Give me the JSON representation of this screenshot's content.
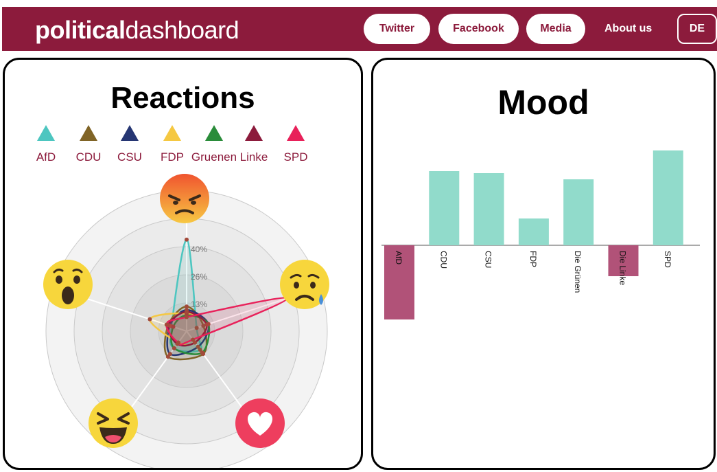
{
  "header": {
    "logo_bold": "political",
    "logo_light": "dashboard",
    "bg_color": "#8c1b3c",
    "nav": {
      "twitter": "Twitter",
      "facebook": "Facebook",
      "media": "Media",
      "about": "About us",
      "lang": "DE"
    }
  },
  "reactions": {
    "title": "Reactions",
    "legend": [
      {
        "label": "AfD",
        "color": "#4dc6c0"
      },
      {
        "label": "CDU",
        "color": "#806426"
      },
      {
        "label": "CSU",
        "color": "#263673"
      },
      {
        "label": "FDP",
        "color": "#f5c842"
      },
      {
        "label": "Gruenen",
        "color": "#2a8c3a"
      },
      {
        "label": "Linke",
        "color": "#8c1b3c"
      },
      {
        "label": "SPD",
        "color": "#e8215a"
      }
    ],
    "emoji_icons": [
      "angry-face-icon",
      "sad-face-icon",
      "heart-icon",
      "laughing-face-icon",
      "wow-face-icon"
    ],
    "ring_labels": [
      "40%",
      "26%",
      "13%"
    ]
  },
  "chart_data": [
    {
      "type": "radar",
      "title": "Reactions",
      "axes": [
        "angry",
        "sad",
        "love",
        "haha",
        "wow"
      ],
      "rmax": 60,
      "tick_labels": [
        "13%",
        "26%",
        "40%"
      ],
      "series": [
        {
          "name": "AfD",
          "color": "#4dc6c0",
          "values": [
            52,
            6,
            13,
            12,
            9
          ]
        },
        {
          "name": "CDU",
          "color": "#806426",
          "values": [
            14,
            10,
            16,
            18,
            11
          ]
        },
        {
          "name": "CSU",
          "color": "#263673",
          "values": [
            12,
            13,
            11,
            16,
            10
          ]
        },
        {
          "name": "FDP",
          "color": "#f5c842",
          "values": [
            10,
            12,
            8,
            8,
            22
          ]
        },
        {
          "name": "Gruenen",
          "color": "#2a8c3a",
          "values": [
            9,
            13,
            15,
            12,
            8
          ]
        },
        {
          "name": "Linke",
          "color": "#8c1b3c",
          "values": [
            11,
            12,
            8,
            9,
            11
          ]
        },
        {
          "name": "SPD",
          "color": "#e8215a",
          "values": [
            8,
            60,
            6,
            8,
            12
          ]
        }
      ]
    },
    {
      "type": "bar",
      "title": "Mood",
      "categories": [
        "AfD",
        "CDU",
        "CSU",
        "FDP",
        "Die Grünen",
        "Die Linke",
        "SPD"
      ],
      "values": [
        -3.6,
        3.6,
        3.5,
        1.3,
        3.2,
        -1.5,
        4.6
      ],
      "ylim": [
        -5,
        5
      ],
      "positive_color": "#91dbcb",
      "negative_color": "#b15278"
    }
  ]
}
